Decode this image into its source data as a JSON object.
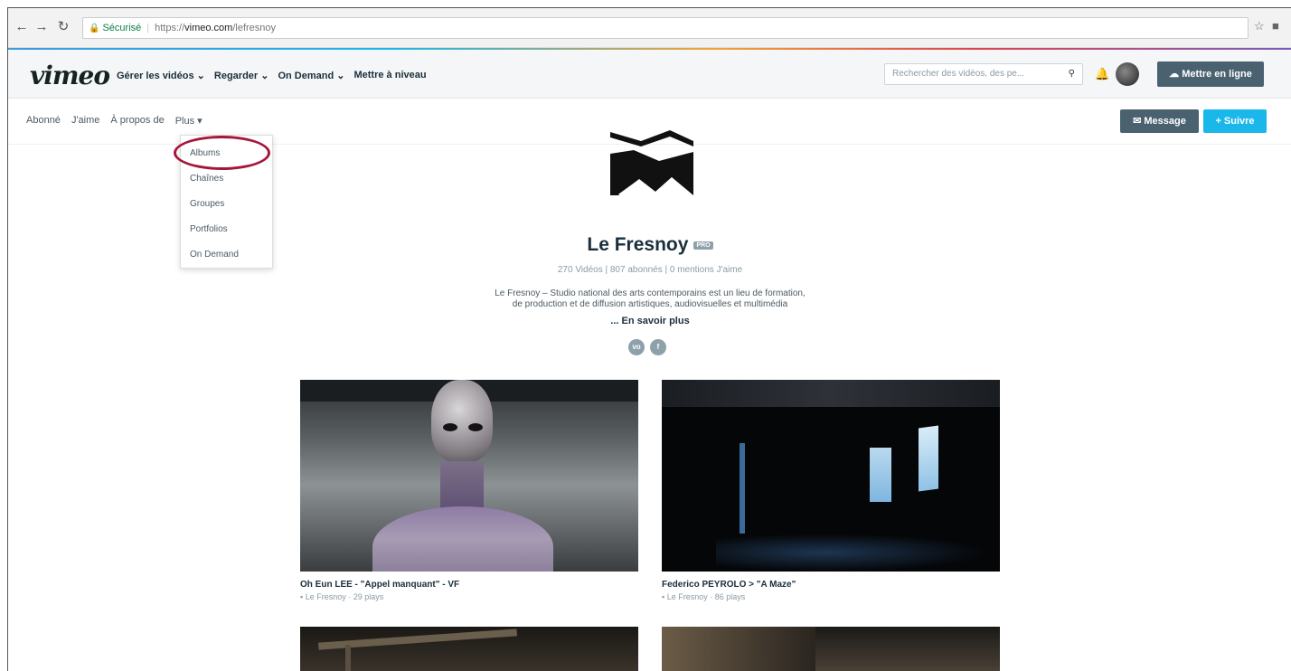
{
  "browser": {
    "secure_label": "Sécurisé",
    "url_prefix": "https://",
    "url_host": "vimeo.com",
    "url_path": "/lefresnoy"
  },
  "topbar": {
    "logo": "vimeo",
    "nav": [
      "Gérer les vidéos ⌄",
      "Regarder ⌄",
      "On Demand ⌄",
      "Mettre à niveau"
    ],
    "search_placeholder": "Rechercher des vidéos, des pe...",
    "upload_label": "Mettre en ligne"
  },
  "profile_nav": {
    "items": [
      "Abonné",
      "J'aime",
      "À propos de",
      "Plus ▾"
    ],
    "message_label": "Message",
    "follow_label": "+ Suivre"
  },
  "dropdown": {
    "items": [
      "Albums",
      "Chaînes",
      "Groupes",
      "Portfolios",
      "On Demand"
    ]
  },
  "profile": {
    "name": "Le Fresnoy",
    "badge": "PRO",
    "stats": "270 Vidéos  |  807 abonnés  |  0 mentions J'aime",
    "bio_line1": "Le Fresnoy – Studio national des arts contemporains est un lieu de formation,",
    "bio_line2": "de production et de diffusion artistiques, audiovisuelles et multimédia",
    "more_label": "... En savoir plus",
    "social": [
      "vimeo",
      "facebook"
    ]
  },
  "videos": [
    {
      "title": "Oh Eun LEE - \"Appel manquant\" - VF",
      "meta": "Le Fresnoy · 29 plays"
    },
    {
      "title": "Federico PEYROLO > \"A Maze\"",
      "meta": "Le Fresnoy · 86 plays"
    }
  ],
  "colors": {
    "accent": "#1ab7ea",
    "dark_button": "#4a6270",
    "highlight_circle": "#a5163a"
  }
}
